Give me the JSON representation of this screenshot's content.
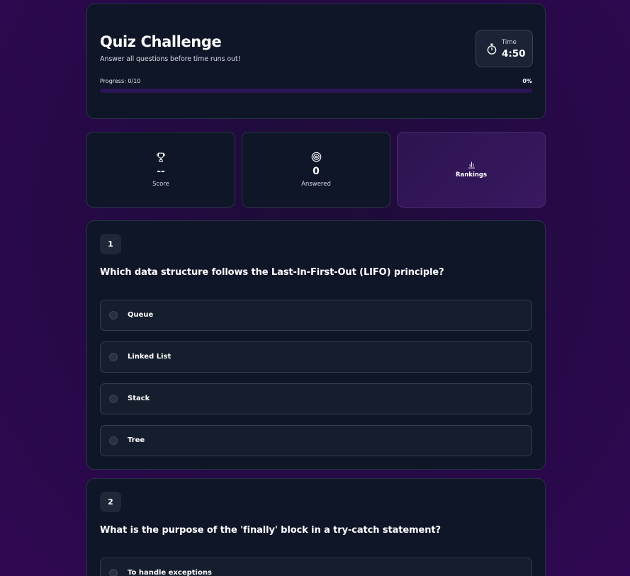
{
  "header": {
    "title": "Quiz Challenge",
    "subtitle": "Answer all questions before time runs out!",
    "timer": {
      "label": "Time",
      "value": "4:50",
      "icon": "stopwatch-icon"
    },
    "progress": {
      "label": "Progress: 0/10",
      "percent_text": "0%",
      "percent": 0
    }
  },
  "stats": {
    "score": {
      "value": "--",
      "label": "Score",
      "icon": "trophy-icon"
    },
    "answered": {
      "value": "0",
      "label": "Answered",
      "icon": "target-icon"
    },
    "rankings": {
      "label": "Rankings",
      "icon": "bar-chart-icon"
    }
  },
  "questions": [
    {
      "number": "1",
      "text": "Which data structure follows the Last-In-First-Out (LIFO) principle?",
      "options": [
        "Queue",
        "Linked List",
        "Stack",
        "Tree"
      ]
    },
    {
      "number": "2",
      "text": "What is the purpose of the 'finally' block in a try-catch statement?",
      "options": [
        "To handle exceptions"
      ]
    }
  ],
  "colors": {
    "accent": "#7c3aed",
    "card_bg": "#0f1627",
    "page_bg": "#240a44",
    "rankings_bg": "#331659"
  }
}
